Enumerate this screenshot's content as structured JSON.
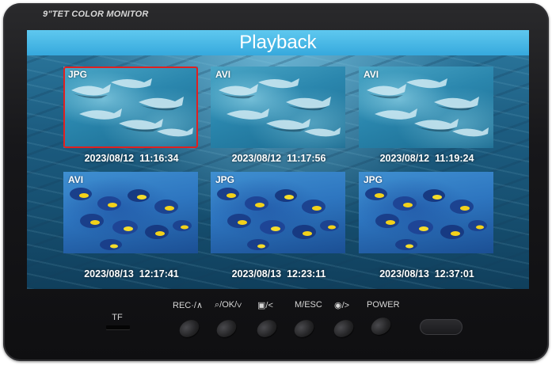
{
  "device": {
    "brand_label": "9\"TET COLOR MONITOR",
    "card_slot_label": "TF"
  },
  "screen": {
    "title": "Playback",
    "title_bar_color": "#36a9dd",
    "selection_color": "#e02020",
    "files": [
      {
        "type": "JPG",
        "timestamp": "2023/08/12  11:16:34",
        "thumbnail": "shark-school",
        "selected": true
      },
      {
        "type": "AVI",
        "timestamp": "2023/08/12  11:17:56",
        "thumbnail": "shark-school",
        "selected": false
      },
      {
        "type": "AVI",
        "timestamp": "2023/08/12  11:19:24",
        "thumbnail": "shark-school",
        "selected": false
      },
      {
        "type": "AVI",
        "timestamp": "2023/08/13  12:17:41",
        "thumbnail": "reef-fish",
        "selected": false
      },
      {
        "type": "JPG",
        "timestamp": "2023/08/13  12:23:11",
        "thumbnail": "reef-fish",
        "selected": false
      },
      {
        "type": "JPG",
        "timestamp": "2023/08/13  12:37:01",
        "thumbnail": "reef-fish",
        "selected": false
      }
    ]
  },
  "buttons": {
    "rec_up": "REC·/∧",
    "zoom_ok_down": "/OK/∨",
    "gallery_left": "/<",
    "menu_esc": "M/ESC",
    "camera_right": "/>",
    "power": "POWER"
  }
}
